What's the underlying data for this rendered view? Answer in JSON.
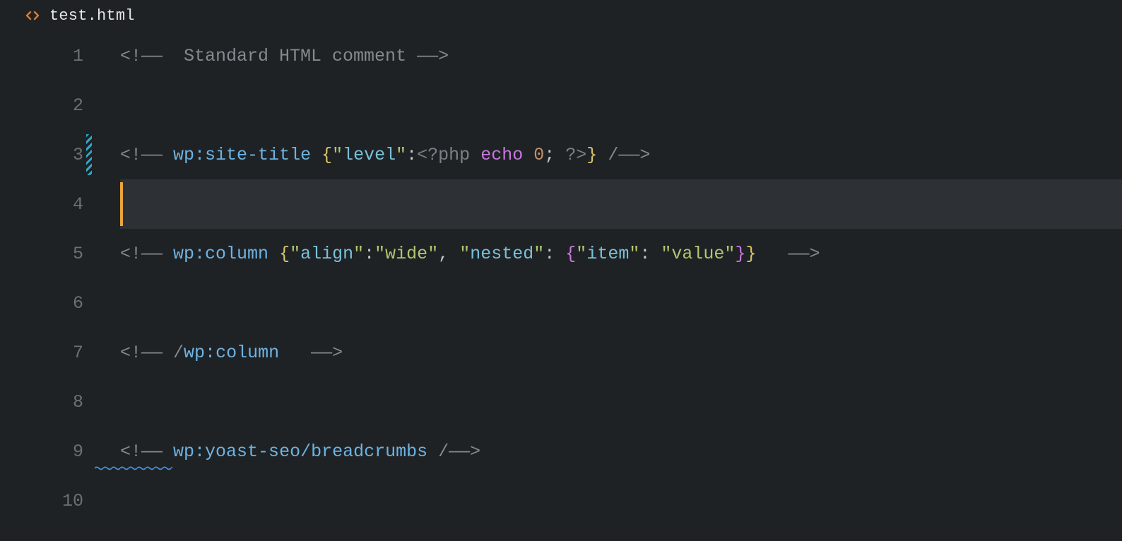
{
  "tab": {
    "filename": "test.html"
  },
  "gutter": {
    "lines": [
      "1",
      "2",
      "3",
      "4",
      "5",
      "6",
      "7",
      "8",
      "9",
      "10"
    ]
  },
  "tokens": {
    "comment_open": "<!—— ",
    "comment_open_plain": "<!——  ",
    "comment_close": " ——>",
    "comment_close_self": " /——>",
    "std_comment": "Standard HTML comment",
    "wp_prefix": "wp",
    "colon": ":",
    "site_title": "site-title",
    "column": "column",
    "yoast": "yoast-seo/breadcrumbs",
    "slash": "/",
    "space": " ",
    "sp2": "  ",
    "brace_open": "{",
    "brace_close": "}",
    "dq": "\"",
    "level": "level",
    "align": "align",
    "wide": "wide",
    "nested": "nested",
    "item": "item",
    "value": "value",
    "comma_sp": ", ",
    "colon_sp": ": ",
    "php_open": "<?php",
    "php_close": "?>",
    "echo": "echo",
    "zero": "0",
    "semi": ";"
  }
}
